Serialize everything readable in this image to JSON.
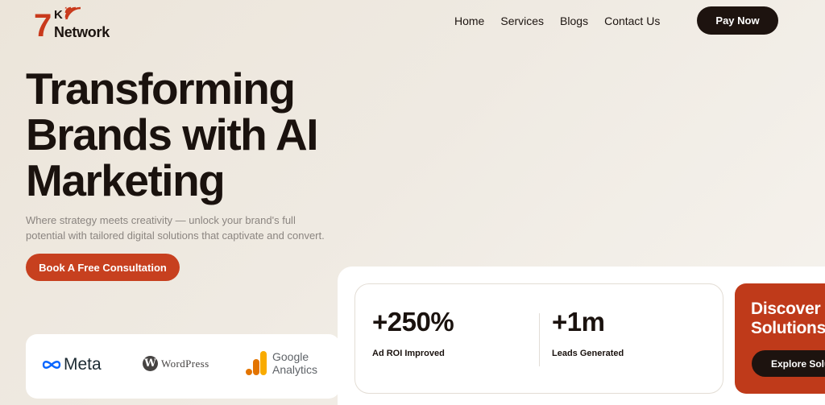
{
  "header": {
    "logo": {
      "number": "7",
      "letter": "K",
      "word": "Network"
    },
    "nav": [
      "Home",
      "Services",
      "Blogs",
      "Contact Us"
    ],
    "pay_button": "Pay Now"
  },
  "hero": {
    "title_lines": [
      "Transforming",
      "Brands with AI",
      "Marketing"
    ],
    "subtitle": "Where strategy meets creativity — unlock your brand's full potential with tailored digital solutions that captivate and convert.",
    "cta": "Book A Free Consultation"
  },
  "partners": {
    "meta": "Meta",
    "wordpress": "WordPress",
    "google_analytics": [
      "Google",
      "Analytics"
    ]
  },
  "stats": [
    {
      "value": "+250%",
      "label": "Ad ROI Improved"
    },
    {
      "value": "+1m",
      "label": "Leads Generated"
    }
  ],
  "discover": {
    "title_lines": [
      "Discover",
      "Solutions"
    ],
    "button": "Explore Solutions"
  },
  "colors": {
    "accent": "#c7401f",
    "dark": "#1d130f",
    "background": "#ece5da"
  },
  "icons": [
    "wifi-signal-icon",
    "meta-infinity-icon",
    "wordpress-icon",
    "google-analytics-icon"
  ]
}
